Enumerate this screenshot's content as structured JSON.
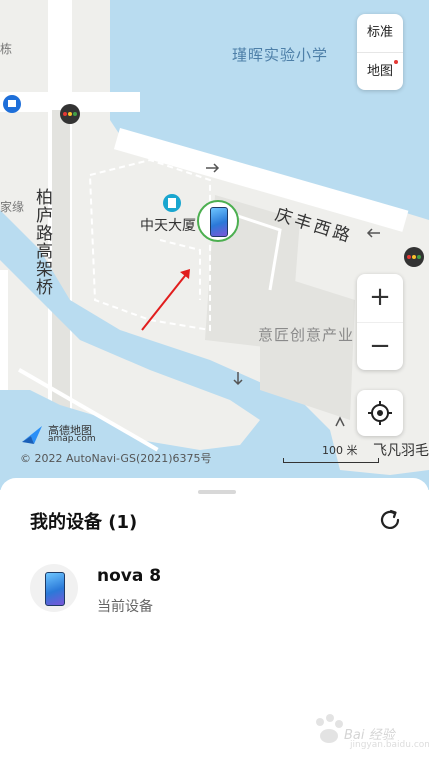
{
  "map": {
    "labels": {
      "school": "瑾晖实验小学",
      "road_east": "庆丰西路",
      "road_north": "柏庐路高架桥",
      "building": "中天大厦",
      "park": "意匠创意产业",
      "left_edge": "家缘",
      "top_left": "栋",
      "bottom_right": "飞凡羽毛"
    },
    "map_type": {
      "standard": "标准",
      "map": "地图"
    },
    "zoom": {
      "in": "+",
      "out": "−"
    },
    "brand": {
      "name": "高德地图",
      "url": "amap.com"
    },
    "copyright": "© 2022 AutoNavi-GS(2021)6375号",
    "scale": "100 米",
    "colors": {
      "water": "#b9dcf0",
      "land": "#efefec",
      "road": "#ffffff",
      "accent_red": "#e53935"
    }
  },
  "panel": {
    "title": "我的设备 (1)",
    "devices": [
      {
        "name": "nova 8",
        "status": "当前设备",
        "icon": "phone-icon"
      }
    ]
  },
  "watermark": {
    "text": "Bai 经验",
    "url": "jingyan.baidu.com"
  }
}
